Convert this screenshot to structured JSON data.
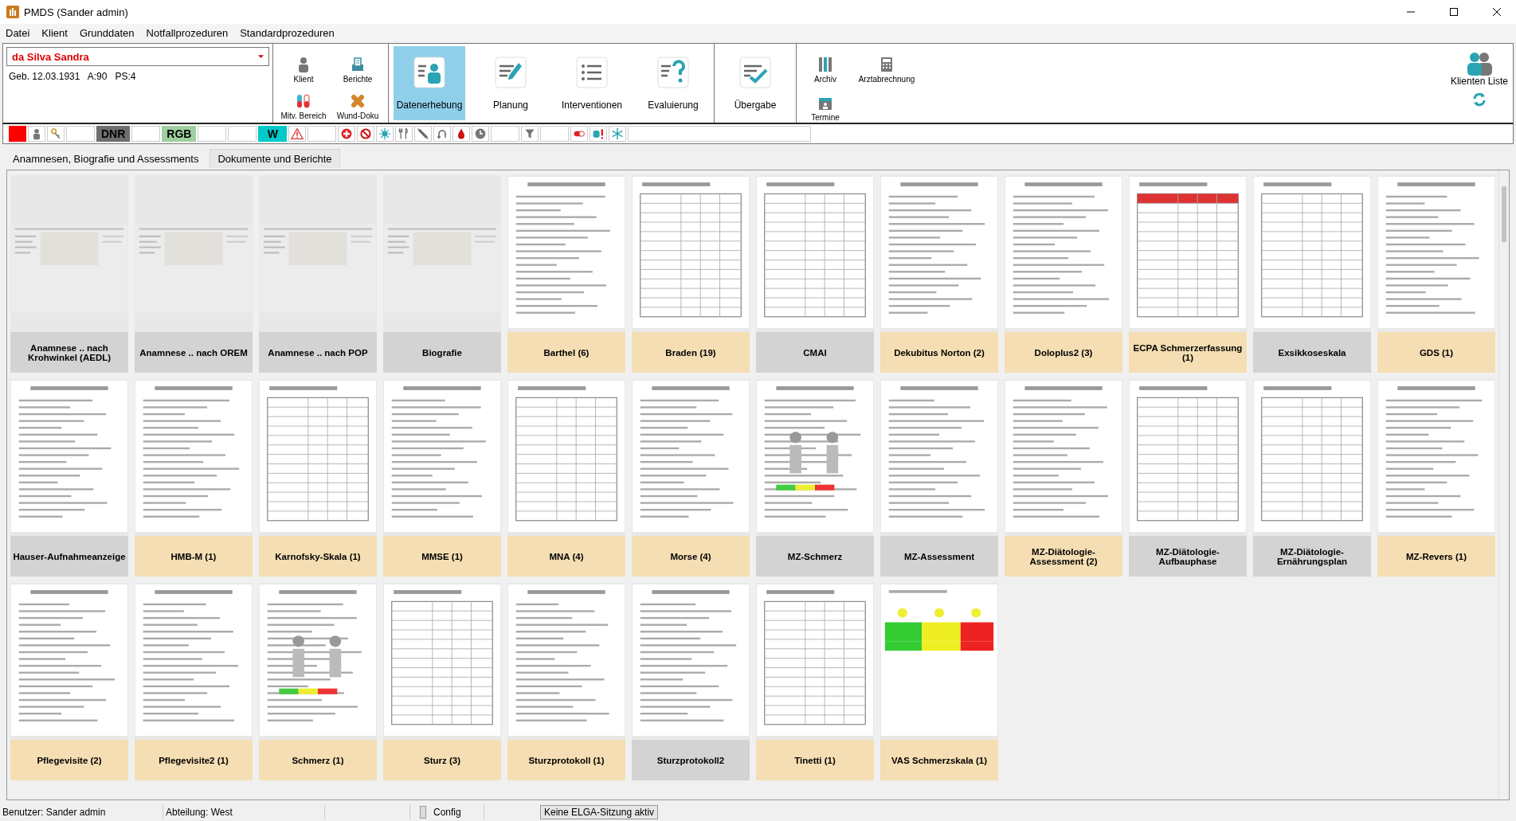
{
  "window": {
    "title": "PMDS (Sander admin)"
  },
  "menu": [
    "Datei",
    "Klient",
    "Grunddaten",
    "Notfallprozeduren",
    "Standardprozeduren"
  ],
  "patient": {
    "name": "da Silva Sandra",
    "info": "Geb. 12.03.1931   A:90   PS:4"
  },
  "small_buttons": [
    {
      "label": "Klient",
      "kind": "person"
    },
    {
      "label": "Berichte",
      "kind": "printer"
    },
    {
      "label": "Mitv. Bereich",
      "kind": "pills"
    },
    {
      "label": "Wund-Doku",
      "kind": "bandage"
    }
  ],
  "big_buttons": [
    {
      "label": "Datenerhebung",
      "kind": "person",
      "selected": true
    },
    {
      "label": "Planung",
      "kind": "pen",
      "selected": false
    },
    {
      "label": "Interventionen",
      "kind": "list",
      "selected": false
    },
    {
      "label": "Evaluierung",
      "kind": "question",
      "selected": false
    }
  ],
  "handover_button": {
    "label": "Übergabe"
  },
  "extra_buttons": [
    {
      "label": "Archiv",
      "kind": "binders"
    },
    {
      "label": "Arztabrechnung",
      "kind": "calculator"
    },
    {
      "label": "Termine",
      "kind": "calendar"
    }
  ],
  "client_list_button": {
    "label": "Klienten Liste"
  },
  "flags": [
    {
      "kind": "swatch",
      "color": "#ff0000"
    },
    {
      "kind": "person"
    },
    {
      "kind": "key"
    },
    {
      "kind": "blank"
    },
    {
      "kind": "text",
      "label": "DNR",
      "color": "#6e6e6e"
    },
    {
      "kind": "blank"
    },
    {
      "kind": "text",
      "label": "RGB",
      "color": "#9fcf9f"
    },
    {
      "kind": "blank"
    },
    {
      "kind": "blank"
    },
    {
      "kind": "text",
      "label": "W",
      "color": "#00c9c9"
    },
    {
      "kind": "warning"
    },
    {
      "kind": "blank"
    },
    {
      "kind": "cross"
    },
    {
      "kind": "forbidden"
    },
    {
      "kind": "sun"
    },
    {
      "kind": "cutlery"
    },
    {
      "kind": "syringe"
    },
    {
      "kind": "arrow"
    },
    {
      "kind": "drop"
    },
    {
      "kind": "clock"
    },
    {
      "kind": "blank"
    },
    {
      "kind": "funnel"
    },
    {
      "kind": "blank"
    },
    {
      "kind": "pill"
    },
    {
      "kind": "alert"
    },
    {
      "kind": "snowflake"
    }
  ],
  "tabs": [
    {
      "label": "Anamnesen, Biografie und Assessments",
      "selected": true
    },
    {
      "label": "Dokumente und Berichte",
      "selected": false
    }
  ],
  "tiles": [
    {
      "label": "Anamnese .. nach Krohwinkel (AEDL)",
      "kind": "screen",
      "color": "#d3d3d3"
    },
    {
      "label": "Anamnese .. nach OREM",
      "kind": "screen",
      "color": "#d3d3d3"
    },
    {
      "label": "Anamnese .. nach POP",
      "kind": "screen",
      "color": "#d3d3d3"
    },
    {
      "label": "Biografie",
      "kind": "screen",
      "color": "#d3d3d3"
    },
    {
      "label": "Barthel (6)",
      "kind": "form",
      "color": "#f5deb3"
    },
    {
      "label": "Braden (19)",
      "kind": "table",
      "color": "#f5deb3"
    },
    {
      "label": "CMAI",
      "kind": "table",
      "color": "#d3d3d3"
    },
    {
      "label": "Dekubitus Norton (2)",
      "kind": "form",
      "color": "#f5deb3"
    },
    {
      "label": "Doloplus2 (3)",
      "kind": "form",
      "color": "#f5deb3"
    },
    {
      "label": "ECPA Schmerzerfassung (1)",
      "kind": "redtable",
      "color": "#f5deb3"
    },
    {
      "label": "Exsikkoseskala",
      "kind": "table",
      "color": "#d3d3d3"
    },
    {
      "label": "GDS (1)",
      "kind": "form",
      "color": "#f5deb3"
    },
    {
      "label": "Hauser-Aufnahmeanzeige",
      "kind": "form",
      "color": "#d3d3d3"
    },
    {
      "label": "HMB-M (1)",
      "kind": "form",
      "color": "#f5deb3"
    },
    {
      "label": "Karnofsky-Skala (1)",
      "kind": "table",
      "color": "#f5deb3"
    },
    {
      "label": "MMSE (1)",
      "kind": "form",
      "color": "#f5deb3"
    },
    {
      "label": "MNA (4)",
      "kind": "table",
      "color": "#f5deb3"
    },
    {
      "label": "Morse (4)",
      "kind": "form",
      "color": "#f5deb3"
    },
    {
      "label": "MZ-Schmerz",
      "kind": "body",
      "color": "#d3d3d3"
    },
    {
      "label": "MZ-Assessment",
      "kind": "form",
      "color": "#d3d3d3"
    },
    {
      "label": "MZ-Diätologie-Assessment (2)",
      "kind": "form",
      "color": "#f5deb3"
    },
    {
      "label": "MZ-Diätologie-Aufbauphase",
      "kind": "table",
      "color": "#d3d3d3"
    },
    {
      "label": "MZ-Diätologie-Ernährungsplan",
      "kind": "table",
      "color": "#d3d3d3"
    },
    {
      "label": "MZ-Revers (1)",
      "kind": "form",
      "color": "#f5deb3"
    },
    {
      "label": "Pflegevisite (2)",
      "kind": "form",
      "color": "#f5deb3"
    },
    {
      "label": "Pflegevisite2 (1)",
      "kind": "form",
      "color": "#f5deb3"
    },
    {
      "label": "Schmerz (1)",
      "kind": "body",
      "color": "#f5deb3"
    },
    {
      "label": "Sturz (3)",
      "kind": "table",
      "color": "#f5deb3"
    },
    {
      "label": "Sturzprotokoll (1)",
      "kind": "form",
      "color": "#f5deb3"
    },
    {
      "label": "Sturzprotokoll2",
      "kind": "form",
      "color": "#d3d3d3"
    },
    {
      "label": "Tinetti (1)",
      "kind": "table",
      "color": "#f5deb3"
    },
    {
      "label": "VAS Schmerzskala (1)",
      "kind": "scale",
      "color": "#f5deb3"
    }
  ],
  "status_bar": {
    "user": "Benutzer: Sander admin",
    "department": "Abteilung: West",
    "config": "Config",
    "elga": "Keine ELGA-Sitzung aktiv"
  }
}
